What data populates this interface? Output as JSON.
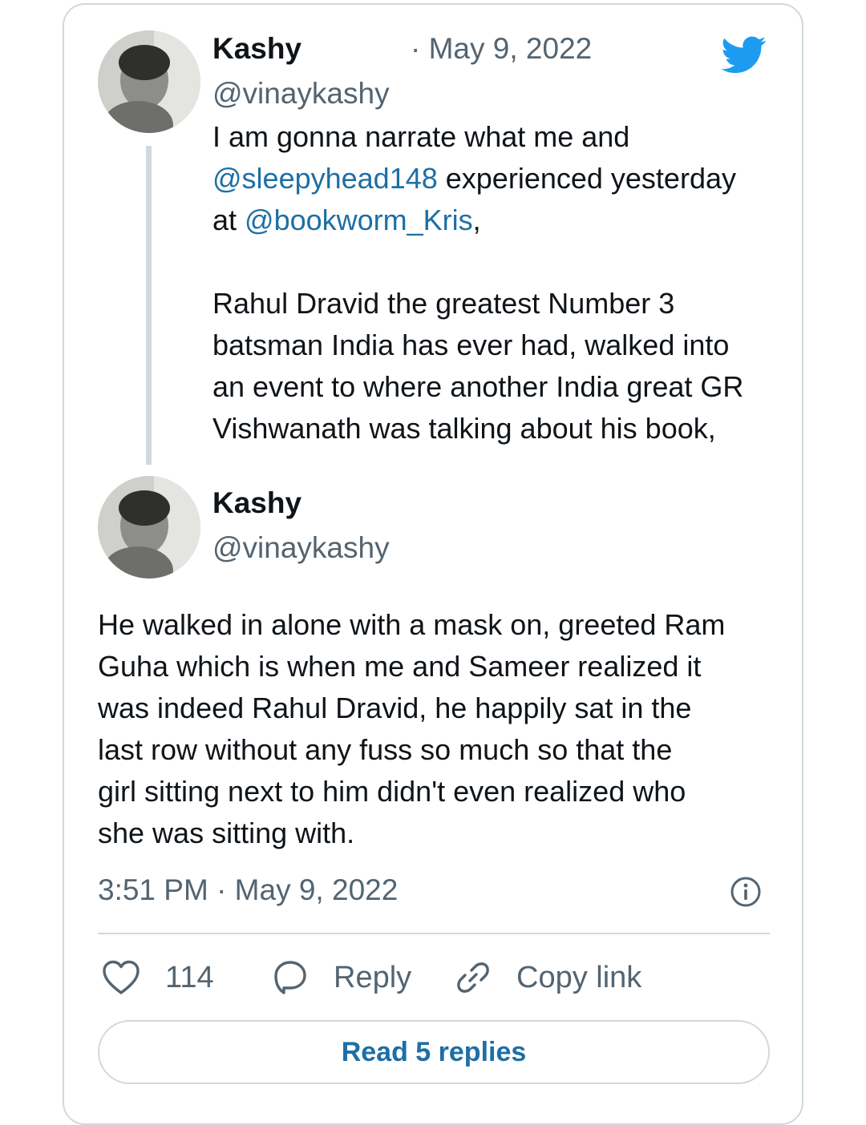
{
  "tweet1": {
    "name": "Kashy",
    "date": "· May 9, 2022",
    "handle": "@vinaykashy",
    "lines": {
      "l1": "I am gonna narrate what me and",
      "l2_mention": "@sleepyhead148",
      "l2_rest": " experienced yesterday",
      "l3_pre": "at ",
      "l3_mention": "@bookworm_Kris",
      "l3_post": ",",
      "l5": "Rahul Dravid the greatest Number 3",
      "l6": "batsman India has ever had, walked into",
      "l7": "an event to where another India great GR",
      "l8": "Vishwanath was talking about his book,"
    }
  },
  "tweet2": {
    "name": "Kashy",
    "handle": "@vinaykashy",
    "lines": [
      "He walked in alone with a mask on, greeted Ram",
      "Guha which is when me and Sameer realized it",
      "was indeed Rahul Dravid, he happily sat in the",
      "last row without any fuss so much so that the",
      "girl sitting next to him didn't even realized who",
      "she was sitting with."
    ],
    "timestamp": "3:51 PM · May 9, 2022"
  },
  "actions": {
    "likes": "114",
    "reply": "Reply",
    "copy_link": "Copy link"
  },
  "read_replies": "Read 5 replies",
  "icons": {
    "brand": "twitter-bird-icon",
    "info": "info-icon",
    "like": "heart-icon",
    "reply": "speech-bubble-icon",
    "copy": "link-icon"
  },
  "colors": {
    "twitter_blue": "#1d9bf0",
    "mention": "#1d6fa5",
    "secondary_text": "#536471",
    "border": "#cfd9de"
  }
}
